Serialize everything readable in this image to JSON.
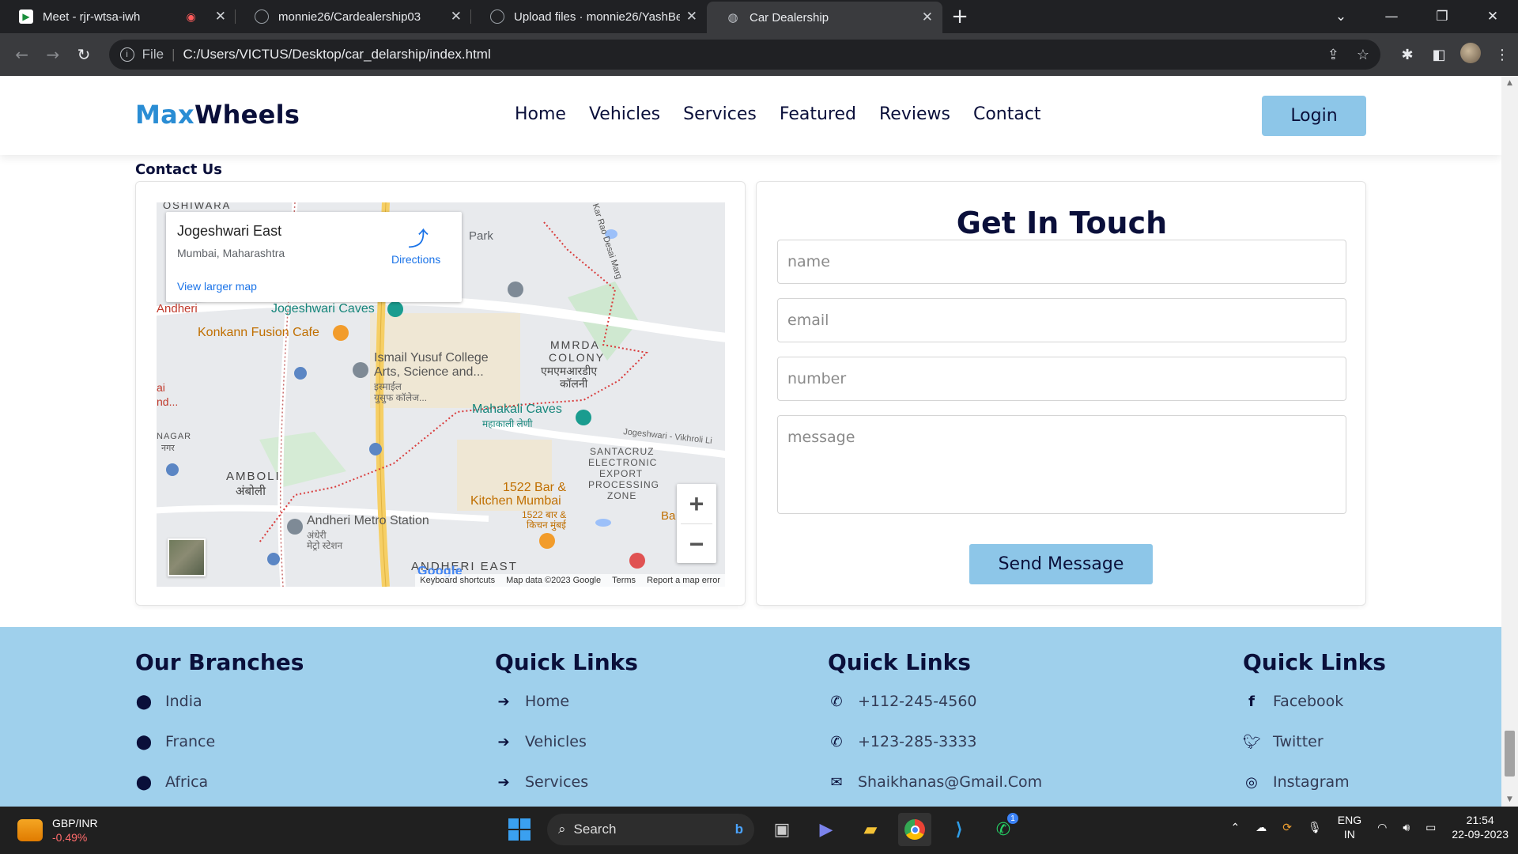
{
  "browser": {
    "tabs": [
      {
        "title": "Meet - rjr-wtsa-iwh",
        "icon": "google-meet-icon",
        "recording": true
      },
      {
        "title": "monnie26/Cardealership03",
        "icon": "github-icon"
      },
      {
        "title": "Upload files · monnie26/YashBe",
        "icon": "github-icon"
      },
      {
        "title": "Car Dealership",
        "icon": "globe-icon",
        "active": true
      }
    ],
    "address": {
      "scheme": "File",
      "url": "C:/Users/VICTUS/Desktop/car_delarship/index.html"
    }
  },
  "site": {
    "logo_part1": "Max",
    "logo_part2": "Wheels",
    "nav": [
      "Home",
      "Vehicles",
      "Services",
      "Featured",
      "Reviews",
      "Contact"
    ],
    "login": "Login",
    "contact_heading": "Contact Us",
    "map": {
      "place": "Jogeshwari East",
      "address": "Mumbai, Maharashtra",
      "directions": "Directions",
      "larger_map": "View larger map",
      "labels": {
        "oshiwara": "OSHIWARA",
        "park": "Park",
        "andheri_w": "Andheri",
        "jogeshwari_caves": "Jogeshwari Caves",
        "konkann": "Konkann Fusion Cafe",
        "ismail1": "Ismail Yusuf College",
        "ismail2": "Arts, Science and...",
        "ismail_hi1": "इस्माईल",
        "ismail_hi2": "युसुफ कॉलेज...",
        "mmrda1": "MMRDA",
        "mmrda2": "COLONY",
        "mmrda_hi1": "एमएमआरडीए",
        "mmrda_hi2": "कॉलनी",
        "mahakali": "Mahakali Caves",
        "mahakali_hi": "महाकाली लेणी",
        "jvlr": "Jogeshwari - Vikhroli Li",
        "seepz1": "SANTACRUZ",
        "seepz2": "ELECTRONIC",
        "seepz3": "EXPORT",
        "seepz4": "PROCESSING",
        "seepz5": "ZONE",
        "amboli": "AMBOLI",
        "amboli_hi": "अंबोली",
        "nagar": "NAGAR",
        "nagar_hi": "नगर",
        "bar1": "1522 Bar &",
        "bar2": "Kitchen Mumbai",
        "bar_hi1": "1522 बार &",
        "bar_hi2": "किचन मुंबई",
        "metro": "Andheri Metro Station",
        "metro_hi1": "अंधेरी",
        "metro_hi2": "मेट्रो स्टेशन",
        "andheri_east": "ANDHERI EAST",
        "desai": "Kar Rao Desai Marg",
        "ba": "Ba",
        "ai": "ai",
        "nd": "nd..."
      },
      "google": "Google",
      "attribution": [
        "Keyboard shortcuts",
        "Map data ©2023 Google",
        "Terms",
        "Report a map error"
      ]
    },
    "form": {
      "title": "Get In Touch",
      "name_placeholder": "name",
      "email_placeholder": "email",
      "number_placeholder": "number",
      "message_placeholder": "message",
      "send": "Send Message"
    },
    "footer": {
      "branches": {
        "title": "Our Branches",
        "items": [
          "India",
          "France",
          "Africa"
        ]
      },
      "quick1": {
        "title": "Quick Links",
        "items": [
          "Home",
          "Vehicles",
          "Services"
        ]
      },
      "quick2": {
        "title": "Quick Links",
        "items": [
          "+112-245-4560",
          "+123-285-3333",
          "Shaikhanas@Gmail.Com"
        ]
      },
      "quick3": {
        "title": "Quick Links",
        "items": [
          "Facebook",
          "Twitter",
          "Instagram"
        ]
      }
    }
  },
  "taskbar": {
    "ticker": "GBP/INR",
    "change": "-0.49%",
    "search": "Search",
    "lang1": "ENG",
    "lang2": "IN",
    "time": "21:54",
    "date": "22-09-2023",
    "whatsapp_badge": "1"
  }
}
